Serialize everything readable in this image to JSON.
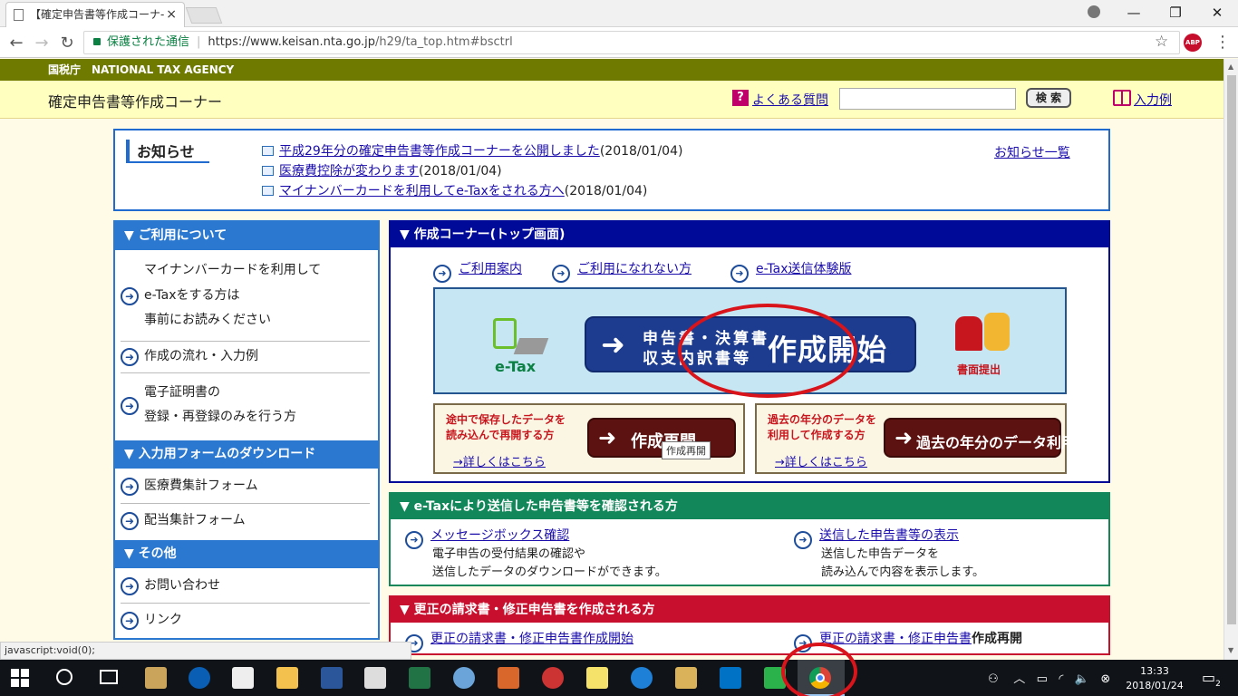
{
  "browser": {
    "tab_title": "【確定申告書等作成コーナ-",
    "tab_close": "×",
    "security_label": "保護された通信",
    "url_host": "https://www.keisan.nta.go.jp",
    "url_path": "/h29/ta_top.htm#bsctrl",
    "status_text": "javascript:void(0);",
    "window_controls": [
      "—",
      "❐",
      "✕"
    ],
    "abp_label": "ABP"
  },
  "site": {
    "agency_line": "国税庁　NATIONAL TAX AGENCY",
    "title": "確定申告書等作成コーナー",
    "faq_label": "よくある質問",
    "search_button": "検 索",
    "search_value": "",
    "example_label": "入力例"
  },
  "news": {
    "heading": "お知らせ",
    "all_link": "お知らせ一覧",
    "items": [
      {
        "link": "平成29年分の確定申告書等作成コーナーを公開しました",
        "date": "(2018/01/04)"
      },
      {
        "link": "医療費控除が変わります",
        "date": "(2018/01/04)"
      },
      {
        "link": "マイナンバーカードを利用してe-Taxをされる方へ",
        "date": "(2018/01/04)"
      }
    ]
  },
  "sidebar": {
    "sections": [
      {
        "heading": "▼ ご利用について"
      },
      {
        "heading": "▼ 入力用フォームのダウンロード"
      },
      {
        "heading": "▼ その他"
      }
    ],
    "items": [
      {
        "l1": "マイナンバーカードを利用して",
        "l2": "e-Taxをする方は",
        "l3": "事前にお読みください"
      },
      {
        "l1": "作成の流れ・入力例"
      },
      {
        "l1": "電子証明書の",
        "l2": "登録・再登録のみを行う方"
      },
      {
        "l1": "医療費集計フォーム"
      },
      {
        "l1": "配当集計フォーム"
      },
      {
        "l1": "お問い合わせ"
      },
      {
        "l1": "リンク"
      }
    ]
  },
  "main": {
    "heading": "▼ 作成コーナー(トップ画面)",
    "links": [
      "ご利用案内",
      "ご利用になれない方",
      "e-Tax送信体験版"
    ],
    "etax_label": "e-Tax",
    "start_line1": "申告書・決算書",
    "start_line2": "収支内訳書等",
    "start_big": "作成開始",
    "paper_label": "書面提出",
    "resume": {
      "desc1": "途中で保存したデータを",
      "desc2": "読み込んで再開する方",
      "button": "作成再開",
      "more": "→詳しくはこちら",
      "tooltip": "作成再開"
    },
    "past": {
      "desc1": "過去の年分のデータを",
      "desc2": "利用して作成する方",
      "button": "過去の年分のデータ利用",
      "more": "→詳しくはこちら"
    }
  },
  "etax_panel": {
    "heading": "▼ e-Taxにより送信した申告書等を確認される方",
    "left_link": "メッセージボックス確認",
    "left_desc1": "電子申告の受付結果の確認や",
    "left_desc2": "送信したデータのダウンロードができます。",
    "right_link": "送信した申告書等の表示",
    "right_desc1": "送信した申告データを",
    "right_desc2": "読み込んで内容を表示します。"
  },
  "correction_panel": {
    "heading": "▼ 更正の請求書・修正申告書を作成される方",
    "left_link": "更正の請求書・修正申告書作成開始",
    "right_link": "更正の請求書・修正申告書",
    "right_bold": "作成再開"
  },
  "taskbar": {
    "time": "13:33",
    "date": "2018/01/24",
    "notif_count": "2",
    "tray_icons": [
      "people-icon",
      "chevron-up-icon",
      "battery-icon",
      "wifi-icon",
      "volume-icon"
    ]
  },
  "colors": {
    "nta_green": "#6f7b00",
    "header_yellow": "#ffffc0",
    "sidebar_blue": "#2a78d0",
    "main_navy": "#000a99",
    "etax_green": "#12875a",
    "correction_red": "#c8102e",
    "annotation_red": "#d9141a"
  }
}
